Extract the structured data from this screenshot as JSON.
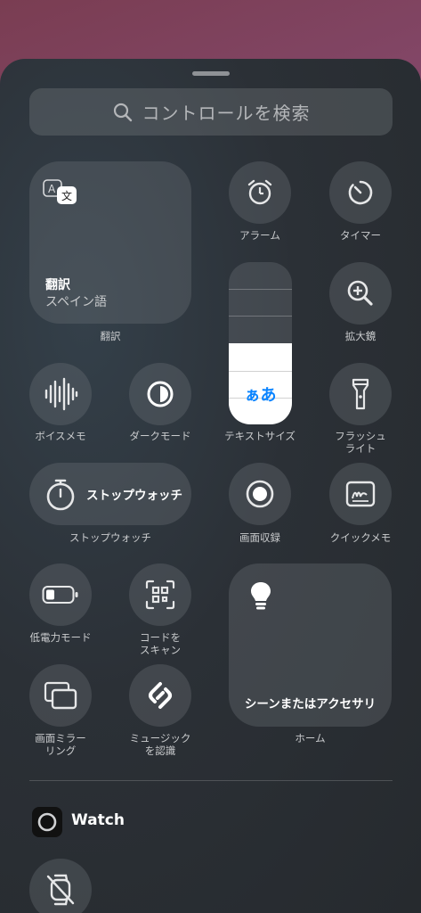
{
  "search": {
    "placeholder": "コントロールを検索"
  },
  "translate": {
    "title": "翻訳",
    "subtitle": "スペイン語",
    "caption": "翻訳"
  },
  "alarm": {
    "label": "アラーム"
  },
  "timer": {
    "label": "タイマー"
  },
  "text_size": {
    "label": "テキストサイズ",
    "glyph": "ぁあ",
    "level_fraction": 0.5
  },
  "magnifier": {
    "label": "拡大鏡"
  },
  "voice_memo": {
    "label": "ボイスメモ"
  },
  "dark_mode": {
    "label": "ダークモード"
  },
  "flashlight": {
    "label": "フラッシュ\nライト"
  },
  "stopwatch": {
    "title": "ストップウォッチ",
    "caption": "ストップウォッチ"
  },
  "screen_record": {
    "label": "画面収録"
  },
  "quick_note": {
    "label": "クイックメモ"
  },
  "low_power": {
    "label": "低電力モード"
  },
  "code_scan": {
    "label": "コードを\nスキャン"
  },
  "home": {
    "title": "シーンまたはアクセサリ",
    "caption": "ホーム"
  },
  "screen_mirror": {
    "label": "画面ミラー\nリング"
  },
  "music_recognize": {
    "label": "ミュージック\nを認識"
  },
  "watch_section": {
    "title": "Watch"
  },
  "colors": {
    "accent_blue": "#0a84ff",
    "tile_bg": "#5c6166"
  }
}
